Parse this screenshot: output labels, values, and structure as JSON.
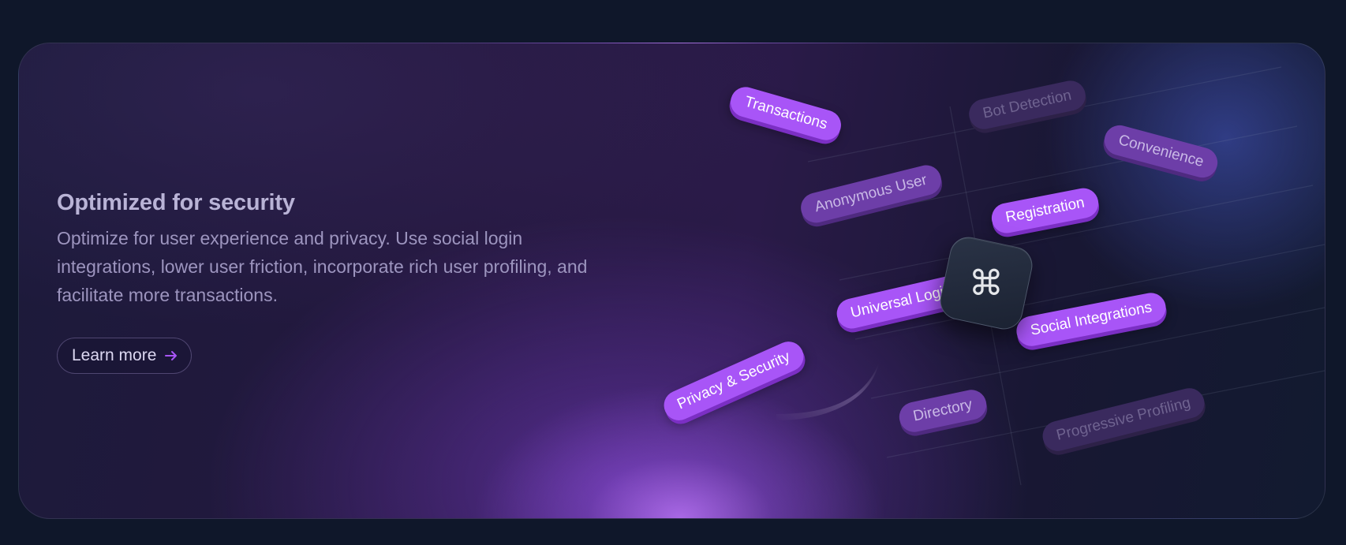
{
  "card": {
    "title": "Optimized for security",
    "description": "Optimize for user experience and privacy. Use social login integrations, lower user friction, incorporate rich user profiling, and facilitate more transactions.",
    "learn_more_label": "Learn more",
    "arrow_icon": "arrow-right-icon",
    "command_icon": "command-key-icon",
    "command_glyph": "⌘"
  },
  "tags": [
    {
      "label": "Transactions",
      "style": "bright"
    },
    {
      "label": "Bot Detection",
      "style": "dim"
    },
    {
      "label": "Convenience",
      "style": "mid"
    },
    {
      "label": "Anonymous User",
      "style": "mid"
    },
    {
      "label": "Registration",
      "style": "bright"
    },
    {
      "label": "Universal Login",
      "style": "bright"
    },
    {
      "label": "Social Integrations",
      "style": "bright"
    },
    {
      "label": "Privacy & Security",
      "style": "bright"
    },
    {
      "label": "Directory",
      "style": "mid"
    },
    {
      "label": "Progressive Profiling",
      "style": "dim"
    }
  ],
  "colors": {
    "accent": "#a855f7",
    "page_bg": "#0f172a"
  }
}
